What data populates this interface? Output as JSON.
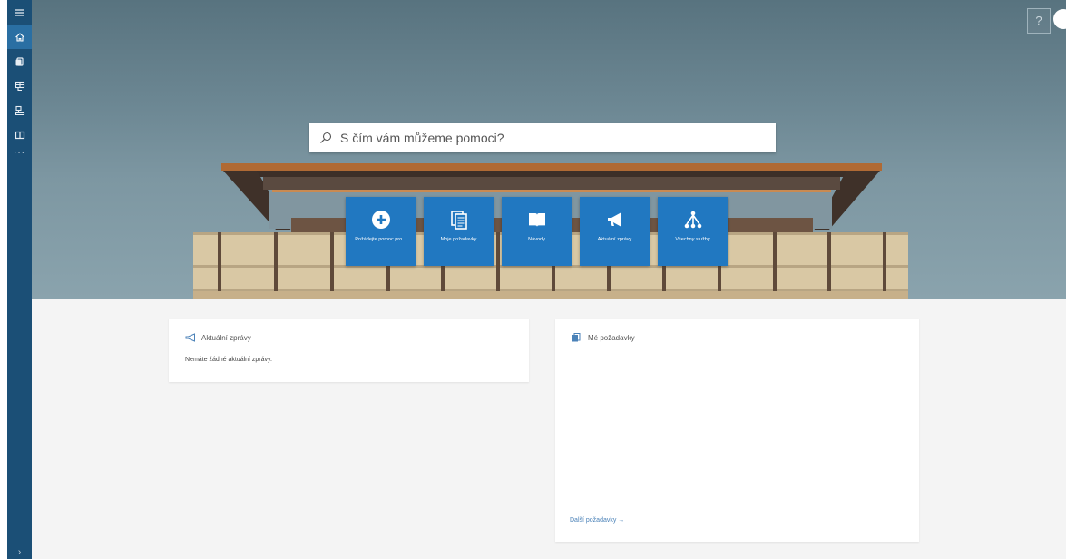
{
  "sidebar": {
    "items": [
      {
        "name": "menu-icon"
      },
      {
        "name": "home-icon"
      },
      {
        "name": "requests-icon"
      },
      {
        "name": "service-catalog-icon"
      },
      {
        "name": "approvals-icon"
      },
      {
        "name": "knowledge-icon"
      }
    ],
    "more": "···",
    "expand": "›"
  },
  "header": {
    "help_label": "?"
  },
  "search": {
    "placeholder": "S čím vám můžeme pomoci?"
  },
  "tiles": [
    {
      "icon": "plus-circle-icon",
      "label": "Požádejte pomoc pro..."
    },
    {
      "icon": "documents-icon",
      "label": "Moje požadavky"
    },
    {
      "icon": "book-icon",
      "label": "Návody"
    },
    {
      "icon": "megaphone-icon",
      "label": "Aktuální zprávy"
    },
    {
      "icon": "hierarchy-icon",
      "label": "Všechny služby"
    }
  ],
  "news_card": {
    "title": "Aktuální zprávy",
    "empty_text": "Nemáte žádné aktuální zprávy."
  },
  "requests_card": {
    "title": "Mé požadavky",
    "more_link": "Další požadavky →"
  },
  "colors": {
    "sidebar": "#1b4f76",
    "sidebar_active": "#2a6fa3",
    "tile": "#2178c1",
    "link": "#4b82b8"
  }
}
